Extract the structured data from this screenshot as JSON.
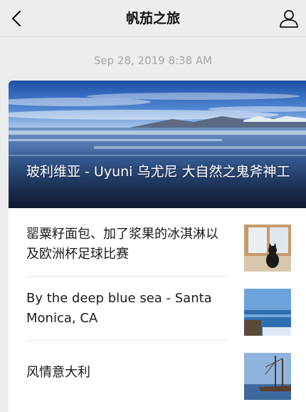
{
  "nav": {
    "title": "帆茄之旅",
    "back_icon": "chevron-left-icon",
    "profile_icon": "person-icon"
  },
  "message": {
    "timestamp": "Sep 28, 2019 8:38 AM"
  },
  "cover": {
    "title": "玻利维亚 -  Uyuni 乌尤尼 大自然之鬼斧神工"
  },
  "articles": [
    {
      "title": "罂粟籽面包、加了浆果的冰淇淋以及欧洲杯足球比赛"
    },
    {
      "title": "By the deep blue sea  - Santa Monica, CA"
    },
    {
      "title": "风情意大利"
    }
  ]
}
